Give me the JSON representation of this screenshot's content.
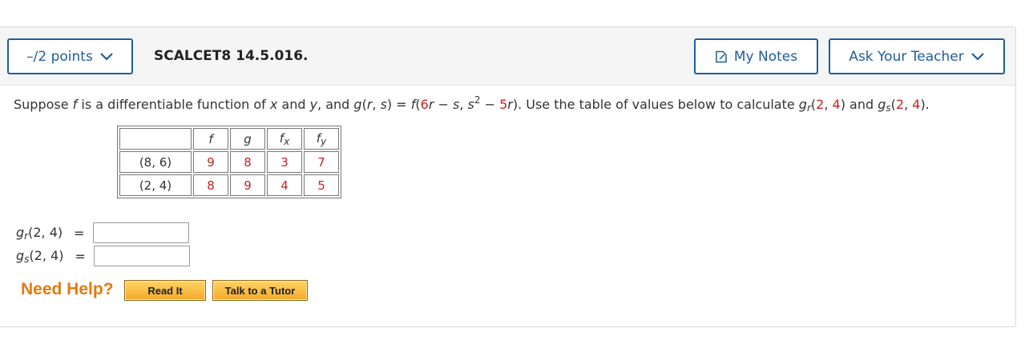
{
  "header": {
    "points_label": "–/2 points",
    "question_id": "SCALCET8 14.5.016.",
    "notes_label": "My Notes",
    "teacher_label": "Ask Your Teacher"
  },
  "prompt": {
    "t1": "Suppose ",
    "f": "f",
    "t2": " is a differentiable function of ",
    "x": "x",
    "t3": " and ",
    "y": "y",
    "t4": ", and ",
    "g": "g",
    "t5": "(",
    "r": "r",
    "t6": ", ",
    "s": "s",
    "t7": ") = ",
    "f2": "f",
    "t8": "(",
    "n6": "6",
    "r2": "r",
    "t9": " − ",
    "s2": "s",
    "t10": ", ",
    "s3": "s",
    "exp2": "2",
    "t11": " − ",
    "n5": "5",
    "r3": "r",
    "t12": ").  Use the table of values below to calculate ",
    "gr_g": "g",
    "gr_sub": "r",
    "gr_args_open": "(",
    "gr_a": "2",
    "gr_comma": ", ",
    "gr_b": "4",
    "gr_close": ")",
    "and": "  and  ",
    "gs_g": "g",
    "gs_sub": "s",
    "gs_args_open": "(",
    "gs_a": "2",
    "gs_comma": ", ",
    "gs_b": "4",
    "gs_close": ")."
  },
  "table": {
    "headers": [
      "f",
      "g",
      "f",
      "f"
    ],
    "header_subs": [
      "",
      "",
      "x",
      "y"
    ],
    "rows": [
      {
        "label": "(8, 6)",
        "values": [
          "9",
          "8",
          "3",
          "7"
        ]
      },
      {
        "label": "(2, 4)",
        "values": [
          "8",
          "9",
          "4",
          "5"
        ]
      }
    ]
  },
  "answers": [
    {
      "g": "g",
      "sub": "r",
      "args": "(2, 4)",
      "eq": "=",
      "value": ""
    },
    {
      "g": "g",
      "sub": "s",
      "args": "(2, 4)",
      "eq": "=",
      "value": ""
    }
  ],
  "help": {
    "label": "Need Help?",
    "read_it": "Read It",
    "talk_tutor": "Talk to a Tutor"
  },
  "colors": {
    "accent": "#1e5e9c",
    "value_red": "#c6231e",
    "help_orange": "#e37a10"
  },
  "icons": {
    "points_chevron": "chevron-down-icon",
    "notes": "note-edit-icon",
    "teacher_chevron": "chevron-down-icon"
  }
}
